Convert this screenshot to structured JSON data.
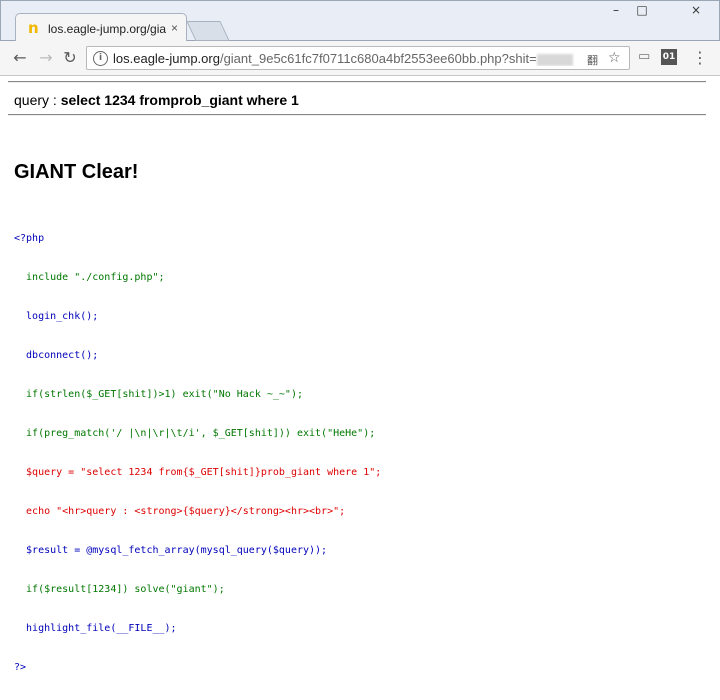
{
  "browser": {
    "tab_title": "los.eagle-jump.org/giant",
    "tab_close": "×",
    "favicon": "n",
    "window_controls": {
      "minimize": "–",
      "maximize": "□",
      "close": "×"
    },
    "nav": {
      "back": "←",
      "forward": "→",
      "reload": "↻"
    },
    "url_host": "los.eagle-jump.org",
    "url_path": "/giant_9e5c61fc7f0711c680a4bf2553ee60bb.php?shit=",
    "info_icon": "i",
    "translate_icon": "翻",
    "star_icon": "☆",
    "ext1": "▭",
    "ext2": "01",
    "menu": "⋮"
  },
  "page": {
    "query_label": "query : ",
    "query_value": "select 1234 fromprob_giant where 1",
    "clear_heading": "GIANT Clear!"
  },
  "code_lines": [
    "<?php",
    "  include \"./config.php\";",
    "  login_chk();",
    "  dbconnect();",
    "  if(strlen($_GET[shit])>1) exit(\"No Hack ~_~\");",
    "  if(preg_match('/ |\\n|\\r|\\t/i', $_GET[shit])) exit(\"HeHe\");",
    "  $query = \"select 1234 from{$_GET[shit]}prob_giant where 1\";",
    "  echo \"<hr>query : <strong>{$query}</strong><hr><br>\";",
    "  $result = @mysql_fetch_array(mysql_query($query));",
    "  if($result[1234]) solve(\"giant\");",
    "  highlight_file(__FILE__);",
    "?>"
  ]
}
